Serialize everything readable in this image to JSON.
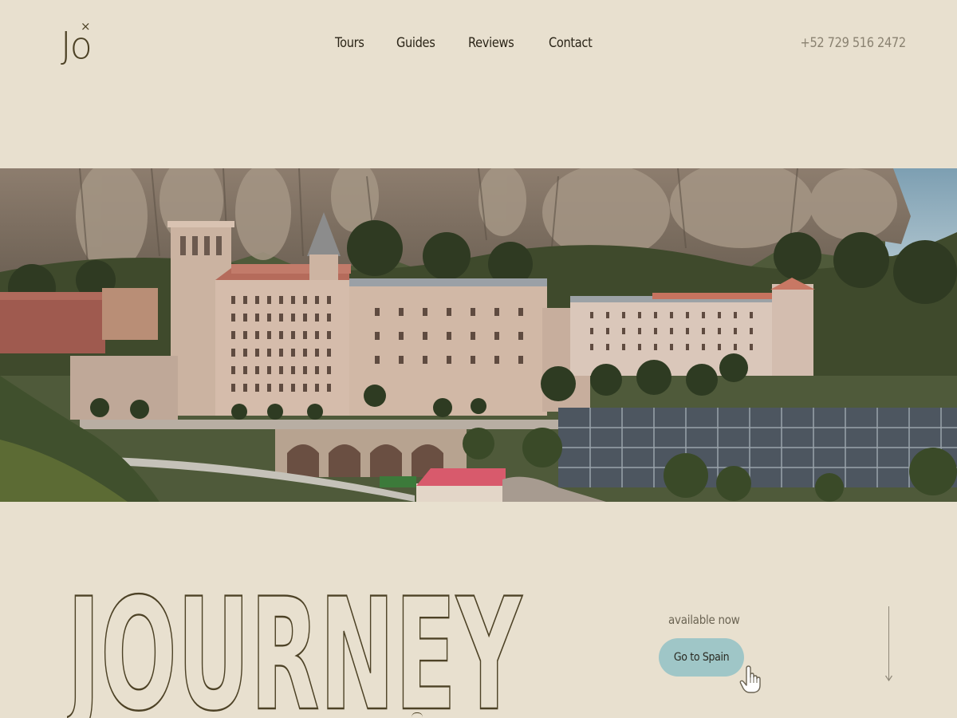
{
  "logo": {
    "text": "Jo",
    "mark": "×"
  },
  "nav": {
    "items": [
      {
        "label": "Tours"
      },
      {
        "label": "Guides"
      },
      {
        "label": "Reviews"
      },
      {
        "label": "Contact"
      }
    ]
  },
  "header": {
    "phone": "+52 729 516 2472"
  },
  "hero": {
    "image": "Montserrat monastery on mountainside"
  },
  "main": {
    "headline": "JOURNEY",
    "available_label": "available now",
    "cta_label": "Go to Spain"
  },
  "colors": {
    "background": "#e8e0cf",
    "accent": "#9fc6c7",
    "text_dark": "#2b2518",
    "outline": "#4d4226",
    "muted": "#8a8271"
  },
  "icons": {
    "pointer": "hand-pointer-icon",
    "scroll": "arrow-down-icon"
  }
}
